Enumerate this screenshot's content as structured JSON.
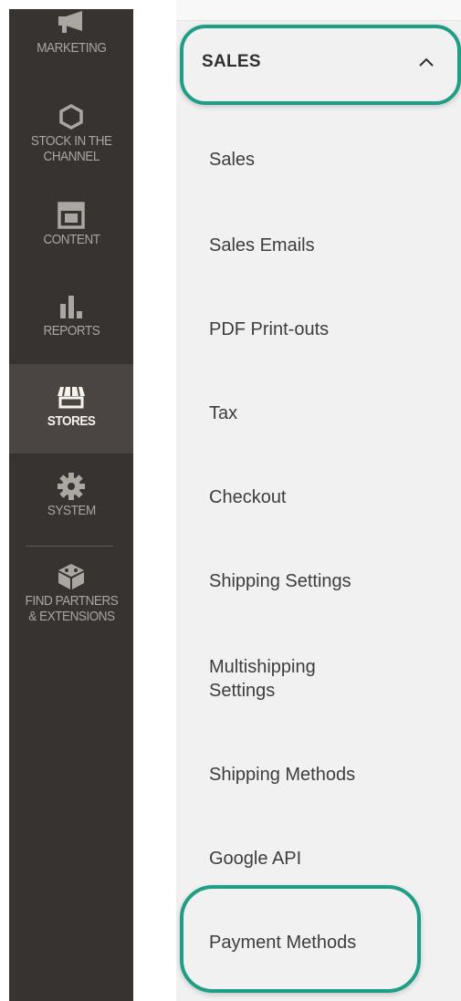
{
  "nav": {
    "items": [
      {
        "id": "marketing",
        "label": "MARKETING",
        "icon": "megaphone-icon"
      },
      {
        "id": "stock",
        "label": "STOCK IN THE\nCHANNEL",
        "icon": "hexagon-icon"
      },
      {
        "id": "content",
        "label": "CONTENT",
        "icon": "layout-icon"
      },
      {
        "id": "reports",
        "label": "REPORTS",
        "icon": "bar-chart-icon"
      },
      {
        "id": "stores",
        "label": "STORES",
        "icon": "storefront-icon",
        "active": true
      },
      {
        "id": "system",
        "label": "SYSTEM",
        "icon": "gear-icon"
      },
      {
        "id": "partners",
        "label": "FIND PARTNERS\n& EXTENSIONS",
        "icon": "cubes-icon"
      }
    ]
  },
  "submenu": {
    "section_title": "SALES",
    "chevron_icon": "chevron-up-icon",
    "items": [
      "Sales",
      "Sales Emails",
      "PDF Print-outs",
      "Tax",
      "Checkout",
      "Shipping Settings",
      "Multishipping\nSettings",
      "Shipping Methods",
      "Google API",
      "Payment Methods"
    ]
  },
  "colors": {
    "nav_bg": "#373330",
    "nav_active_bg": "#4a4542",
    "submenu_bg": "#f1f1f1",
    "highlight": "#1f9e86"
  }
}
